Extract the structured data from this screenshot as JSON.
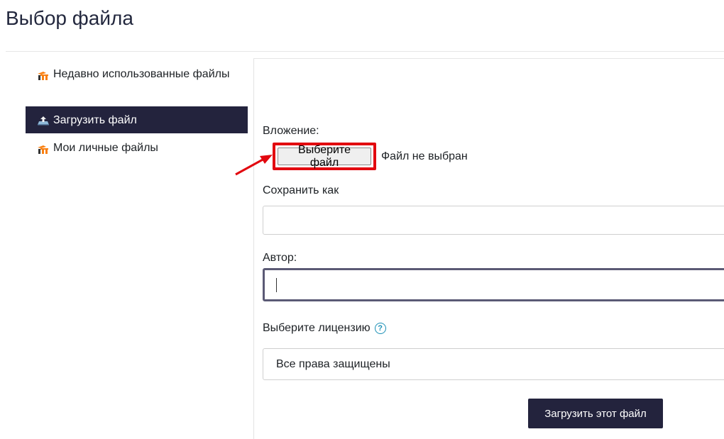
{
  "page": {
    "title": "Выбор файла"
  },
  "sidebar": {
    "items": [
      {
        "label": "Недавно использованные файлы",
        "icon": "moodle-logo-icon",
        "active": false
      },
      {
        "label": "Загрузить файл",
        "icon": "upload-icon",
        "active": true
      },
      {
        "label": "Мои личные файлы",
        "icon": "moodle-logo-icon",
        "active": false
      }
    ]
  },
  "form": {
    "attachment_label": "Вложение:",
    "choose_file_button": "Выберите файл",
    "no_file_text": "Файл не выбран",
    "save_as_label": "Сохранить как",
    "save_as_value": "",
    "author_label": "Автор:",
    "author_value": "",
    "license_label": "Выберите лицензию",
    "license_selected": "Все права защищены",
    "submit_button": "Загрузить этот файл"
  },
  "colors": {
    "accent_dark": "#23233d",
    "highlight_red": "#e2080f",
    "help_icon": "#1a8fb5"
  }
}
